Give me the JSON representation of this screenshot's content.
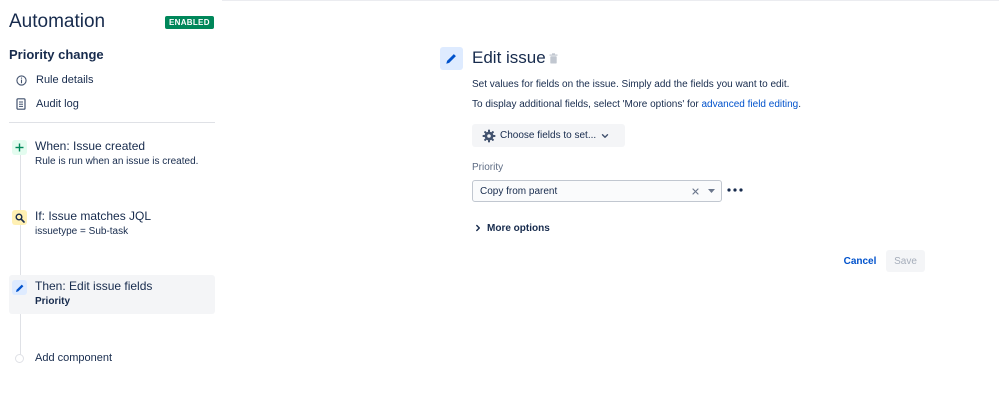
{
  "sidebar": {
    "app_title": "Automation",
    "status_badge": "ENABLED",
    "rule_name": "Priority change",
    "nav": [
      {
        "label": "Rule details",
        "icon": "info-icon"
      },
      {
        "label": "Audit log",
        "icon": "document-icon"
      }
    ],
    "components": [
      {
        "title": "When: Issue created",
        "subtitle": "Rule is run when an issue is created.",
        "icon": "plus-icon",
        "color": "#e3fcef"
      },
      {
        "title": "If: Issue matches JQL",
        "subtitle": "issuetype = Sub-task",
        "icon": "search-icon",
        "color": "#fff0b3"
      },
      {
        "title": "Then: Edit issue fields",
        "subtitle": "Priority",
        "icon": "pencil-icon",
        "color": "#deebff"
      }
    ],
    "add_component": "Add component"
  },
  "main": {
    "title": "Edit issue",
    "desc1": "Set values for fields on the issue. Simply add the fields you want to edit.",
    "desc2_prefix": "To display additional fields, select 'More options' for ",
    "desc2_link": "advanced field editing",
    "desc2_suffix": ".",
    "choose_fields_label": "Choose fields to set...",
    "field_label": "Priority",
    "field_value": "Copy from parent",
    "more_options_label": "More options",
    "cancel_label": "Cancel",
    "save_label": "Save"
  },
  "colors": {
    "accent": "#0052cc",
    "enabled": "#00875a",
    "text": "#172b4d"
  }
}
